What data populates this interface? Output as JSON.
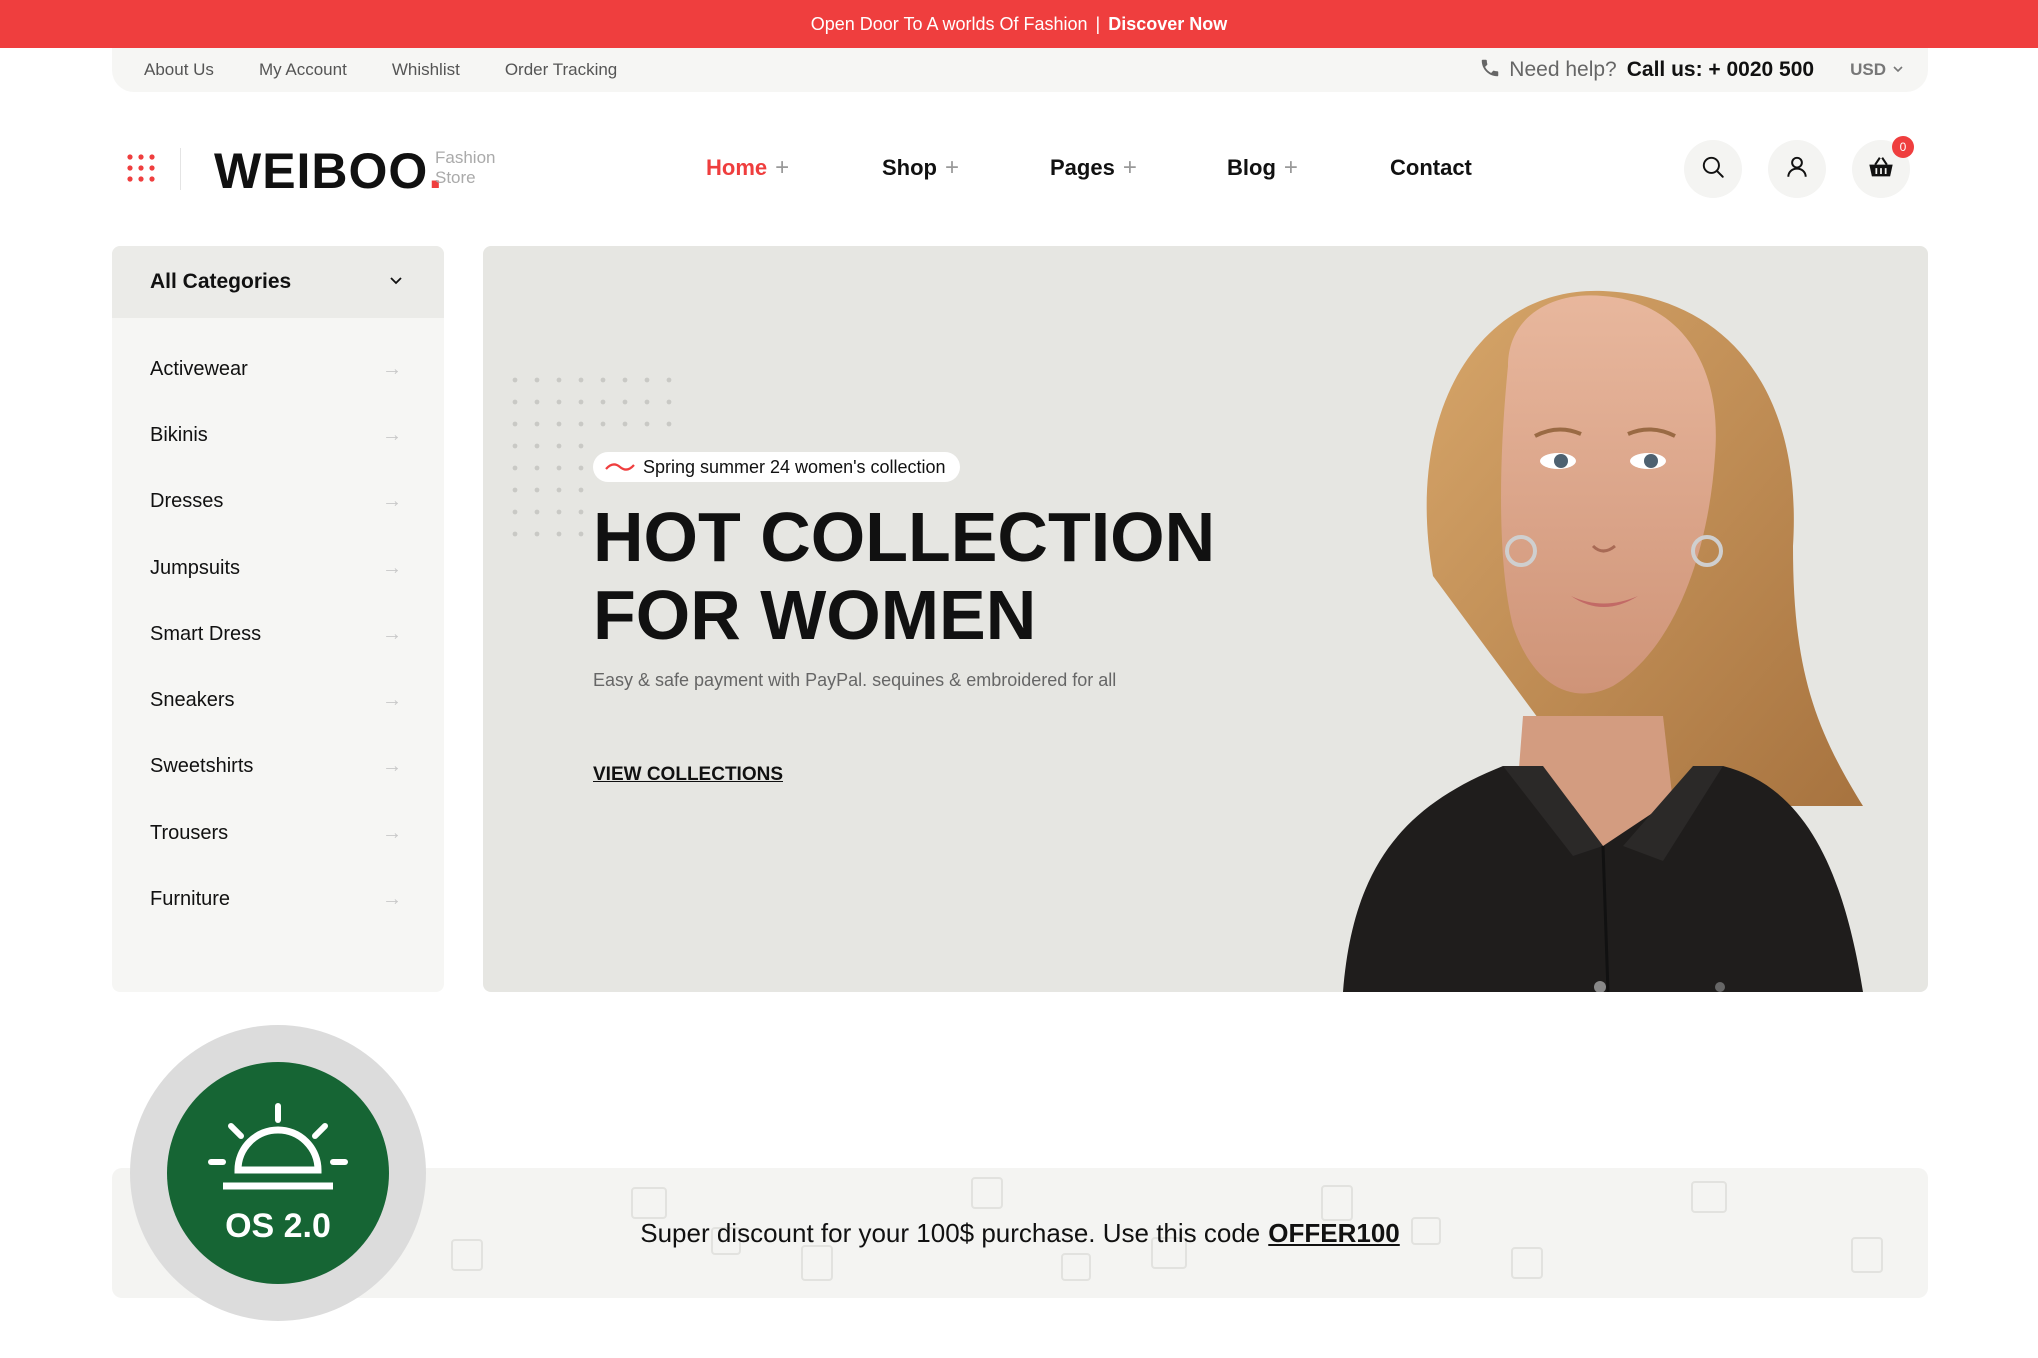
{
  "topbar": {
    "text": "Open Door To A worlds Of Fashion",
    "separator": "|",
    "cta": "Discover Now"
  },
  "utility": {
    "links": [
      "About Us",
      "My Account",
      "Whishlist",
      "Order Tracking"
    ],
    "help_label": "Need help?",
    "call_label": "Call us: + 0020 500",
    "currency": "USD"
  },
  "header": {
    "logo": "WEIBOO",
    "logo_dot": ".",
    "logo_sub_1": "Fashion",
    "logo_sub_2": "Store",
    "nav": [
      {
        "label": "Home",
        "has_submenu": true,
        "active": true
      },
      {
        "label": "Shop",
        "has_submenu": true
      },
      {
        "label": "Pages",
        "has_submenu": true
      },
      {
        "label": "Blog",
        "has_submenu": true
      },
      {
        "label": "Contact",
        "has_submenu": false
      }
    ],
    "plus": "+",
    "cart_count": "0",
    "icons": [
      "search-icon",
      "user-icon",
      "basket-icon"
    ]
  },
  "sidebar": {
    "title": "All Categories",
    "categories": [
      "Activewear",
      "Bikinis",
      "Dresses",
      "Jumpsuits",
      "Smart Dress",
      "Sneakers",
      "Sweetshirts",
      "Trousers",
      "Furniture"
    ]
  },
  "hero": {
    "tag": "Spring summer 24 women's collection",
    "title_line1": "HOT COLLECTION",
    "title_line2": "FOR WOMEN",
    "subtitle": "Easy & safe payment with PayPal. sequines & embroidered for all",
    "link": "VIEW COLLECTIONS"
  },
  "os_badge": {
    "label": "OS 2.0"
  },
  "promo": {
    "text": "Super discount for your 100$ purchase. Use this code",
    "code": "OFFER100"
  },
  "colors": {
    "accent": "#ef3e3e",
    "badge_green": "#166534",
    "panel": "#f6f6f4"
  }
}
